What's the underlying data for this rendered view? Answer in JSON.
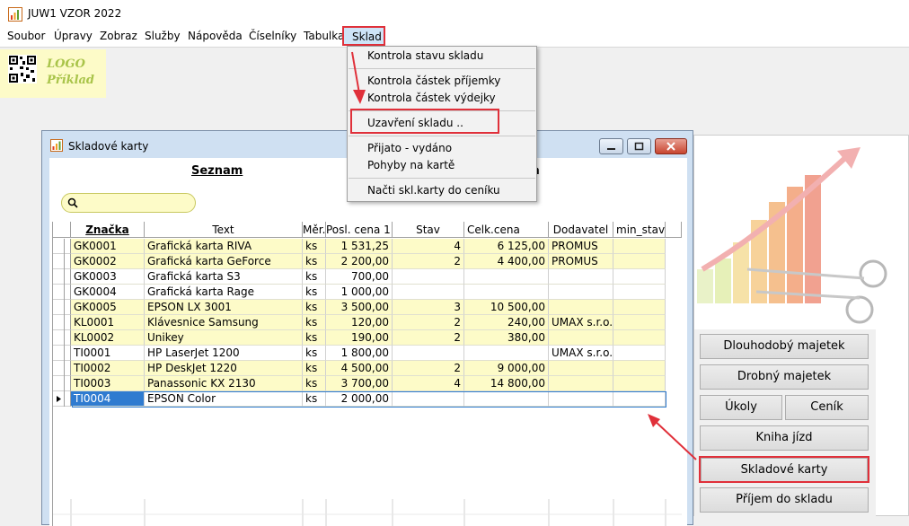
{
  "app": {
    "title": "JUW1 VZOR 2022"
  },
  "menubar": {
    "items": [
      "Soubor",
      "Úpravy",
      "Zobraz",
      "Služby",
      "Nápověda",
      "Číselníky",
      "Tabulka",
      "Sklad"
    ]
  },
  "logo": {
    "line1": "LOGO",
    "line2": "Příklad"
  },
  "dropdown": {
    "items": [
      "Kontrola stavu skladu",
      "Kontrola částek příjemky",
      "Kontrola částek výdejky",
      "Uzavření skladu ..",
      "Přijato - vydáno",
      "Pohyby na kartě",
      "Načti skl.karty do ceníku"
    ]
  },
  "child_window": {
    "title": "Skladové karty",
    "tabs": [
      "Seznam",
      "a"
    ],
    "search": {
      "value": "",
      "placeholder": ""
    },
    "columns": [
      "Značka",
      "Text",
      "Měr.j",
      "Posl. cena 1",
      "Stav",
      "Celk.cena",
      "Dodavatel",
      "min_stav"
    ],
    "rows": [
      {
        "code": "GK0001",
        "text": "Grafická karta RIVA",
        "unit": "ks",
        "price": "1 531,25",
        "stock": "4",
        "total": "6 125,00",
        "supplier": "PROMUS",
        "min": "",
        "bg": "yellow"
      },
      {
        "code": "GK0002",
        "text": "Grafická karta GeForce",
        "unit": "ks",
        "price": "2 200,00",
        "stock": "2",
        "total": "4 400,00",
        "supplier": "PROMUS",
        "min": "",
        "bg": "yellow"
      },
      {
        "code": "GK0003",
        "text": "Grafická karta S3",
        "unit": "ks",
        "price": "700,00",
        "stock": "",
        "total": "",
        "supplier": "",
        "min": "",
        "bg": "white"
      },
      {
        "code": "GK0004",
        "text": "Grafická karta Rage",
        "unit": "ks",
        "price": "1 000,00",
        "stock": "",
        "total": "",
        "supplier": "",
        "min": "",
        "bg": "white"
      },
      {
        "code": "GK0005",
        "text": "EPSON LX 3001",
        "unit": "ks",
        "price": "3 500,00",
        "stock": "3",
        "total": "10 500,00",
        "supplier": "",
        "min": "",
        "bg": "yellow"
      },
      {
        "code": "KL0001",
        "text": "Klávesnice Samsung",
        "unit": "ks",
        "price": "120,00",
        "stock": "2",
        "total": "240,00",
        "supplier": "UMAX s.r.o.",
        "min": "",
        "bg": "yellow"
      },
      {
        "code": "KL0002",
        "text": "Unikey",
        "unit": "ks",
        "price": "190,00",
        "stock": "2",
        "total": "380,00",
        "supplier": "",
        "min": "",
        "bg": "yellow"
      },
      {
        "code": "TI0001",
        "text": "HP LaserJet 1200",
        "unit": "ks",
        "price": "1 800,00",
        "stock": "",
        "total": "",
        "supplier": "UMAX s.r.o.",
        "min": "",
        "bg": "white"
      },
      {
        "code": "TI0002",
        "text": "HP DeskJet 1220",
        "unit": "ks",
        "price": "4 500,00",
        "stock": "2",
        "total": "9 000,00",
        "supplier": "",
        "min": "",
        "bg": "yellow"
      },
      {
        "code": "TI0003",
        "text": "Panassonic KX 2130",
        "unit": "ks",
        "price": "3 700,00",
        "stock": "4",
        "total": "14 800,00",
        "supplier": "",
        "min": "",
        "bg": "yellow"
      },
      {
        "code": "TI0004",
        "text": "EPSON Color",
        "unit": "ks",
        "price": "2 000,00",
        "stock": "",
        "total": "",
        "supplier": "",
        "min": "",
        "bg": "white",
        "current": true
      }
    ]
  },
  "right_buttons": {
    "dlouhodoby": "Dlouhodobý majetek",
    "drobny": "Drobný majetek",
    "ukoly": "Úkoly",
    "cenik": "Ceník",
    "kniha": "Kniha jízd",
    "skladove": "Skladové karty",
    "prijem": "Příjem do skladu"
  },
  "colors": {
    "highlight": "#e0303a",
    "row_yellow": "#fdfbc8",
    "selection": "#2f7bd0"
  }
}
